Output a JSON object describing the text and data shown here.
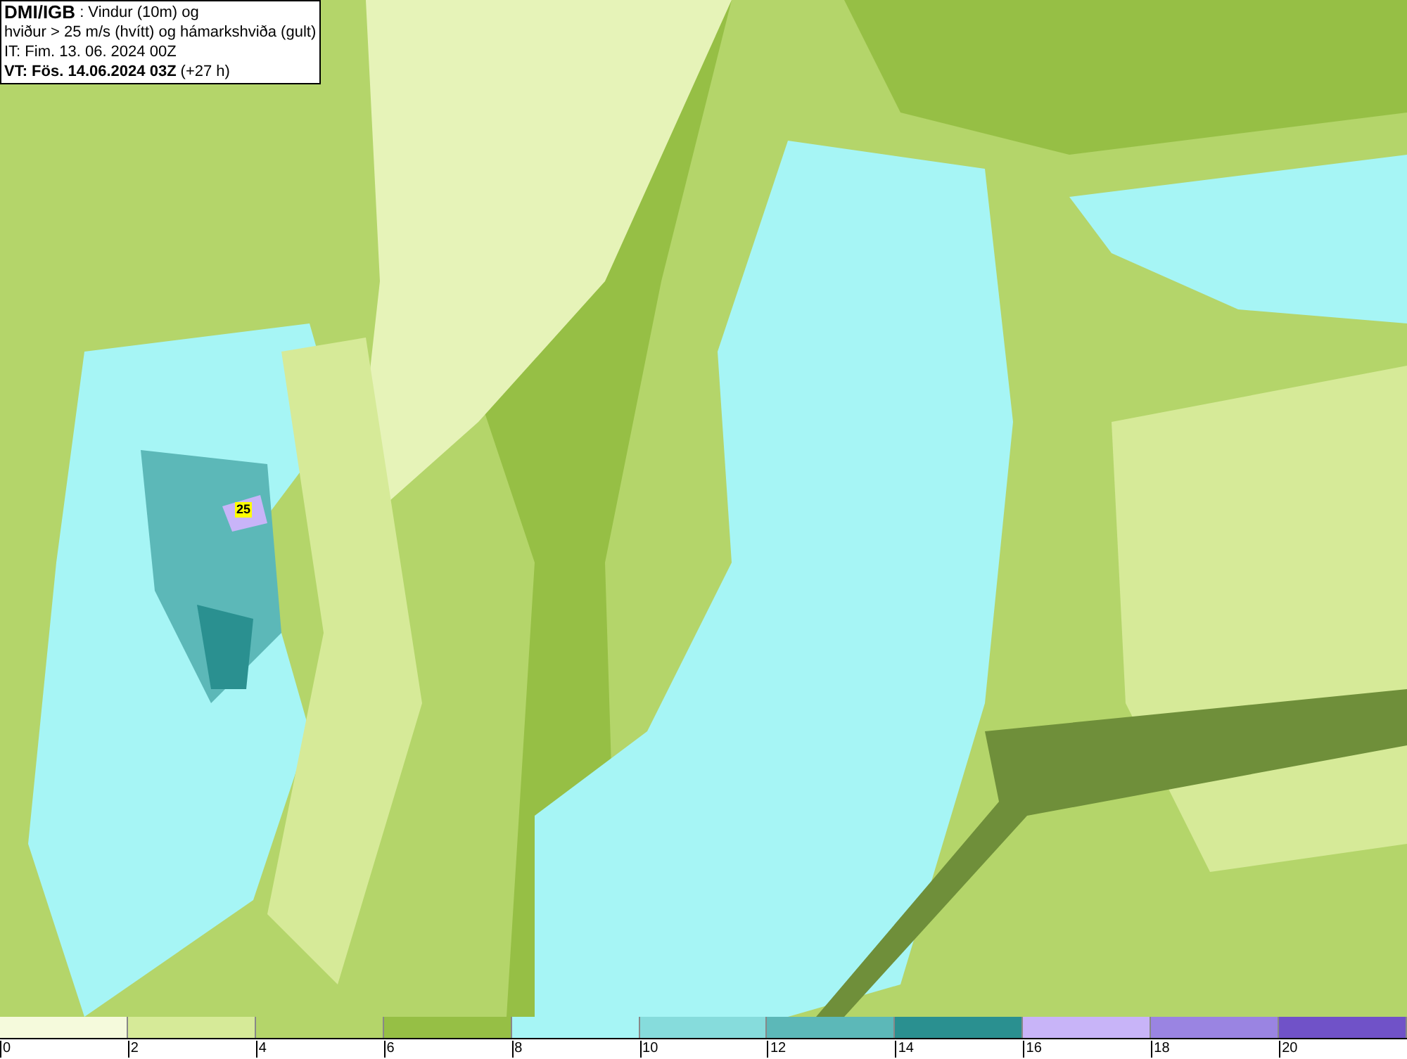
{
  "header": {
    "title": "DMI/IGB",
    "subtitle": ": Vindur (10m) og",
    "line_2": "hviður > 25 m/s (hvítt) og hámarkshviða (gult)",
    "line_3": "IT: Fim. 13. 06. 2024 00Z",
    "valid_time": "VT: Fös. 14.06.2024 03Z",
    "offset": "(+27 h)"
  },
  "map": {
    "gust_label": "25"
  },
  "legend": {
    "bins": [
      {
        "color": "#f5fadc"
      },
      {
        "color": "#d6ea98"
      },
      {
        "color": "#b4d56a"
      },
      {
        "color": "#96bf45"
      },
      {
        "color": "#a6f5f5"
      },
      {
        "color": "#86dcdc"
      },
      {
        "color": "#5cb8b8"
      },
      {
        "color": "#2a9090"
      },
      {
        "color": "#c8b4f8"
      },
      {
        "color": "#9a84e2"
      },
      {
        "color": "#7052c8"
      }
    ],
    "ticks": [
      "0",
      "2",
      "4",
      "6",
      "8",
      "10",
      "12",
      "14",
      "16",
      "18",
      "20"
    ]
  }
}
